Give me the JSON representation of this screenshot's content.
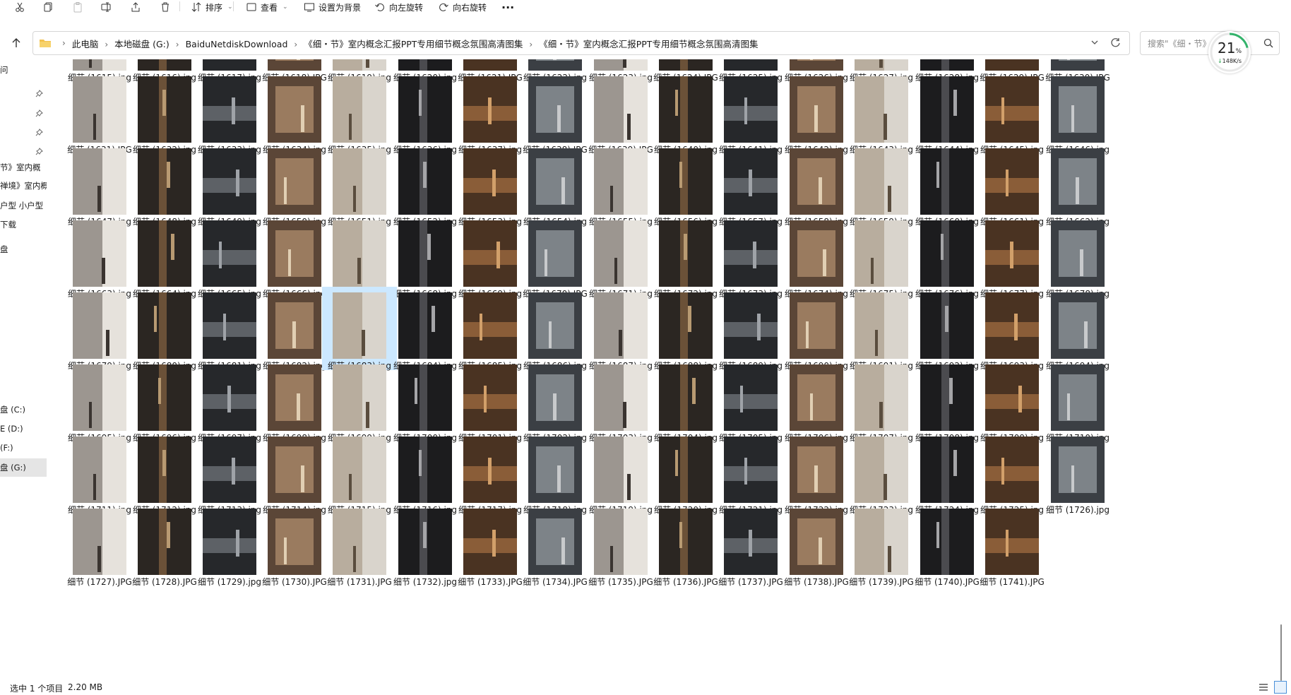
{
  "toolbar": {
    "items": [
      {
        "icon": "cut-icon",
        "label": ""
      },
      {
        "icon": "copy-icon",
        "label": ""
      },
      {
        "icon": "paste-icon",
        "label": ""
      },
      {
        "icon": "rename-icon",
        "label": ""
      },
      {
        "icon": "share-icon",
        "label": ""
      },
      {
        "icon": "delete-icon",
        "label": ""
      },
      {
        "icon": "sort-icon",
        "label": "排序",
        "caret": true
      },
      {
        "icon": "view-icon",
        "label": "查看",
        "caret": true
      },
      {
        "icon": "set-background-icon",
        "label": "设置为背景"
      },
      {
        "icon": "rotate-left-icon",
        "label": "向左旋转"
      },
      {
        "icon": "rotate-right-icon",
        "label": "向右旋转"
      },
      {
        "icon": "more-icon",
        "label": "···"
      }
    ]
  },
  "address": {
    "crumbs": [
      "此电脑",
      "本地磁盘 (G:)",
      "BaiduNetdiskDownload",
      "《细・节》室内概念汇报PPT专用细节概念氛围高清图集",
      "《细・节》室内概念汇报PPT专用细节概念氛围高清图集"
    ]
  },
  "search": {
    "placeholder": "搜索\"《细・节》"
  },
  "speed_widget": {
    "percent": "21",
    "percent_unit": "%",
    "rate": "148K/s",
    "rate_arrow": "↓"
  },
  "sidebar": {
    "items": [
      {
        "label": "问",
        "pinned": false
      },
      {
        "label": "",
        "pinned": true
      },
      {
        "label": "",
        "pinned": true
      },
      {
        "label": "",
        "pinned": true
      },
      {
        "label": "",
        "pinned": true
      },
      {
        "label": "节》室内概",
        "pinned": false
      },
      {
        "label": "禅境》室内概",
        "pinned": false
      },
      {
        "label": "户型 小户型",
        "pinned": false
      },
      {
        "label": "下载",
        "pinned": false
      },
      {
        "label": "盘",
        "pinned": false
      },
      {
        "label": "盘 (C:)",
        "pinned": false
      },
      {
        "label": "E (D:)",
        "pinned": false
      },
      {
        "label": "(F:)",
        "pinned": false
      },
      {
        "label": "盘 (G:)",
        "pinned": false,
        "selected": true
      }
    ]
  },
  "files": {
    "prefix": "细节",
    "first_row_start": 1615,
    "last_number": 1741,
    "selected": 1683,
    "upper_ext_numbers": [
      1618,
      1621,
      1624,
      1629,
      1630,
      1631,
      1638,
      1639,
      1670,
      1727,
      1728,
      1730,
      1731,
      1733,
      1734,
      1735,
      1736,
      1737,
      1738,
      1739,
      1740,
      1741
    ]
  },
  "status": {
    "count": "选中 1 个项目",
    "size": "2.20 MB"
  },
  "colors": {
    "selection": "#cce8ff",
    "accent": "#0078d4",
    "sidebar_selected": "#e5e5e5"
  }
}
